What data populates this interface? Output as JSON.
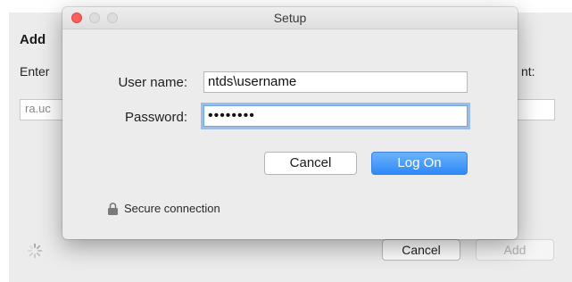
{
  "background_window": {
    "title": "Add",
    "prompt_left": "Enter",
    "prompt_right": "nt:",
    "field_value": "ra.uc",
    "cancel_label": "Cancel",
    "add_label": "Add"
  },
  "dialog": {
    "title": "Setup",
    "username_label": "User name:",
    "username_value": "ntds\\username",
    "password_label": "Password:",
    "password_value": "••••••••",
    "cancel_label": "Cancel",
    "logon_label": "Log On",
    "secure_text": "Secure connection"
  },
  "icons": {
    "close": "close-icon",
    "minimize": "minimize-icon",
    "maximize": "maximize-icon",
    "lock": "lock-icon",
    "spinner": "spinner-icon"
  },
  "colors": {
    "primary_button": "#2e89f6",
    "focus_ring": "#5c98e2",
    "close_button": "#fc605c"
  }
}
